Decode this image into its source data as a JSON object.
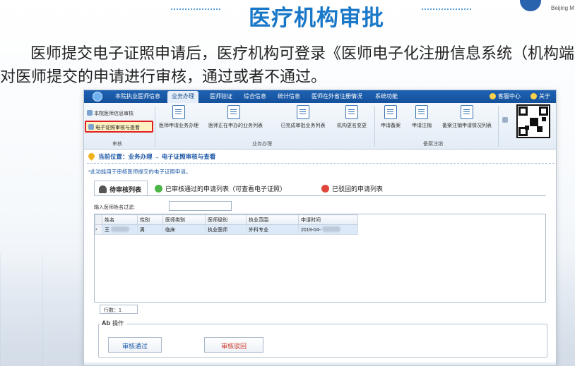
{
  "slide": {
    "title": "医疗机构审批",
    "logo_text": "Beijing M",
    "line1": "医师提交电子证照申请后，医疗机构可登录《医师电子化注册信息系统（机构端",
    "line2": "对医师提交的申请进行审核，通过或者不通过。"
  },
  "menubar": {
    "items": [
      "本院执业医师信息",
      "业务办理",
      "医师验证",
      "综合信息",
      "统计信息",
      "医师在外省注册情况",
      "系统功能"
    ],
    "active": "业务办理",
    "right": [
      "客服中心",
      "关于"
    ]
  },
  "ribbon": {
    "left_items": [
      "本院医师信息审核",
      "电子证照审核与查看"
    ],
    "left_group": "审核",
    "buttons": [
      "医师申请业务办理",
      "医师正在申办的业务列表",
      "已完成审批业务列表",
      "机构更名变更",
      "申请备案",
      "申请注销",
      "备案注销申请情况列表"
    ],
    "group_mid": "业务办理",
    "group_right": "备案注销"
  },
  "location": "当前位置：业务办理 → 电子证照审核与查看",
  "note": "*此功能用于审核医师提交的电子证照申请。",
  "tabs": [
    {
      "label": "待审核列表",
      "icon": "user-icon",
      "active": true
    },
    {
      "label": "已审核通过的申请列表（可查看电子证照）",
      "icon": "check-circle-icon",
      "active": false
    },
    {
      "label": "已驳回的申请列表",
      "icon": "x-circle-icon",
      "active": false
    }
  ],
  "filter": {
    "label": "输入医师姓名过滤:",
    "value": ""
  },
  "grid": {
    "columns": [
      "姓名",
      "性别",
      "医师类别",
      "医师级别",
      "执业范围",
      "申请时间"
    ],
    "rows": [
      [
        "王",
        "男",
        "临床",
        "执业医师",
        "外科专业",
        "2019-04-"
      ]
    ]
  },
  "row_count": "行数：1",
  "ops": {
    "label": "操作",
    "approve": "审核通过",
    "reject": "审核驳回"
  },
  "colors": {
    "accent": "#1a78c8",
    "menubar": "#1a5aa8",
    "highlight": "#e02020",
    "reject": "#d13a2a"
  }
}
